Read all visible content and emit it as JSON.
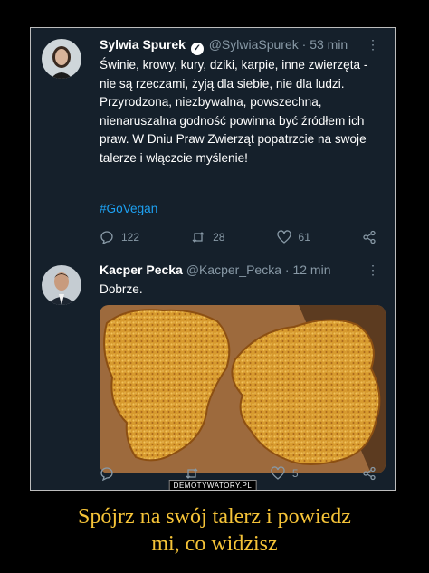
{
  "tweet1": {
    "name": "Sylwia Spurek",
    "handle": "@SylwiaSpurek",
    "time": "· 53 min",
    "text": "Świnie, krowy, kury, dziki, karpie, inne zwierzęta - nie są rzeczami, żyją dla siebie, nie dla ludzi. Przyrodzona, niezbywalna, powszechna, nienaruszalna godność powinna być źródłem ich praw. W Dniu Praw Zwierząt popatrzcie na swoje talerze i włączcie myślenie!",
    "hashtag": "#GoVegan",
    "replies": "122",
    "retweets": "28",
    "likes": "61"
  },
  "tweet2": {
    "name": "Kacper Pecka",
    "handle": "@Kacper_Pecka",
    "time": "· 12 min",
    "text": "Dobrze.",
    "replies": "",
    "retweets": "",
    "likes": "5"
  },
  "watermark": "DEMOTYWATORY.PL",
  "caption": {
    "line1": "Spójrz na swój talerz i powiedz",
    "line2": "mi, co widzisz"
  },
  "colors": {
    "background": "#15202b",
    "accent": "#1da1f2",
    "caption": "#f5c338",
    "muted": "#8899a6"
  }
}
